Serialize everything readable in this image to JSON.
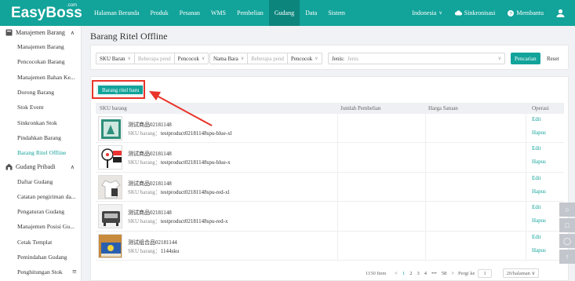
{
  "app": {
    "logo": "EasyBoss",
    "logo_suffix": ".com",
    "nav": [
      "Halaman Beranda",
      "Produk",
      "Pesanan",
      "WMS",
      "Pembelian",
      "Gudang",
      "Data",
      "Sistem"
    ],
    "active_nav_index": 5,
    "region": "Indonesia",
    "sync_label": "Sinkronisasi",
    "help_label": "Membantu",
    "accent": "#12a39a"
  },
  "sidebar": {
    "group1": "Manajemen Barang",
    "group1_items": [
      "Manajemen Barang",
      "Pencocokan Barang",
      "Manajemen Bahan Ke...",
      "Dorong Barang",
      "Stok Event",
      "Sinkronkan Stok",
      "Pindahkan Barang",
      "Barang Ritel Offline"
    ],
    "active_item": "Barang Ritel Offline",
    "group2": "Gudang Pribadi",
    "group2_items": [
      "Daftar Gudang",
      "Catatan pengiriman da...",
      "Pengaturan Gudang",
      "Manajemen Posisi Gu...",
      "Cetak Templat",
      "Pemindahan Gudang",
      "Penghitungan Stok"
    ]
  },
  "page": {
    "title": "Barang Ritel Offline"
  },
  "filters": {
    "sku_select": "SKU Baran",
    "sku_placeholder": "Beberapa pend",
    "sku_match": "Pencocok",
    "name_select": "Nama Bara",
    "name_placeholder": "Beberapa pend",
    "name_match": "Pencocok",
    "jenis_label": "Jenis:",
    "jenis_placeholder": "Jenis",
    "search_button": "Pencarian",
    "reset_button": "Reset"
  },
  "table": {
    "new_button": "Barang ritel baru",
    "columns": [
      "SKU barang",
      "Jumlah Pembelian",
      "Harga Satuan",
      "Operasi"
    ],
    "sku_key": "SKU barang：",
    "edit_label": "Edit",
    "delete_label": "Hapus",
    "rows": [
      {
        "name": "测试商品02181148",
        "sku": "testproduct02181148spu-blue-xl",
        "thumb": "green-box-icon"
      },
      {
        "name": "测试商品02181148",
        "sku": "testproduct02181148spu-blue-x",
        "thumb": "fan-icon"
      },
      {
        "name": "测试商品02181148",
        "sku": "testproduct02181148spu-red-xl",
        "thumb": "clothing-icon"
      },
      {
        "name": "测试商品02181148",
        "sku": "testproduct02181148spu-red-x",
        "thumb": "machine-icon"
      },
      {
        "name": "测试组合品02181144",
        "sku": "1144sku",
        "thumb": "bed-icon"
      }
    ]
  },
  "pagination": {
    "total": "1150 Item",
    "pages": [
      "1",
      "2",
      "3",
      "4",
      "•••",
      "58"
    ],
    "goto_label": "Pergi ke",
    "goto_value": "1",
    "page_size": "20/halaman"
  }
}
